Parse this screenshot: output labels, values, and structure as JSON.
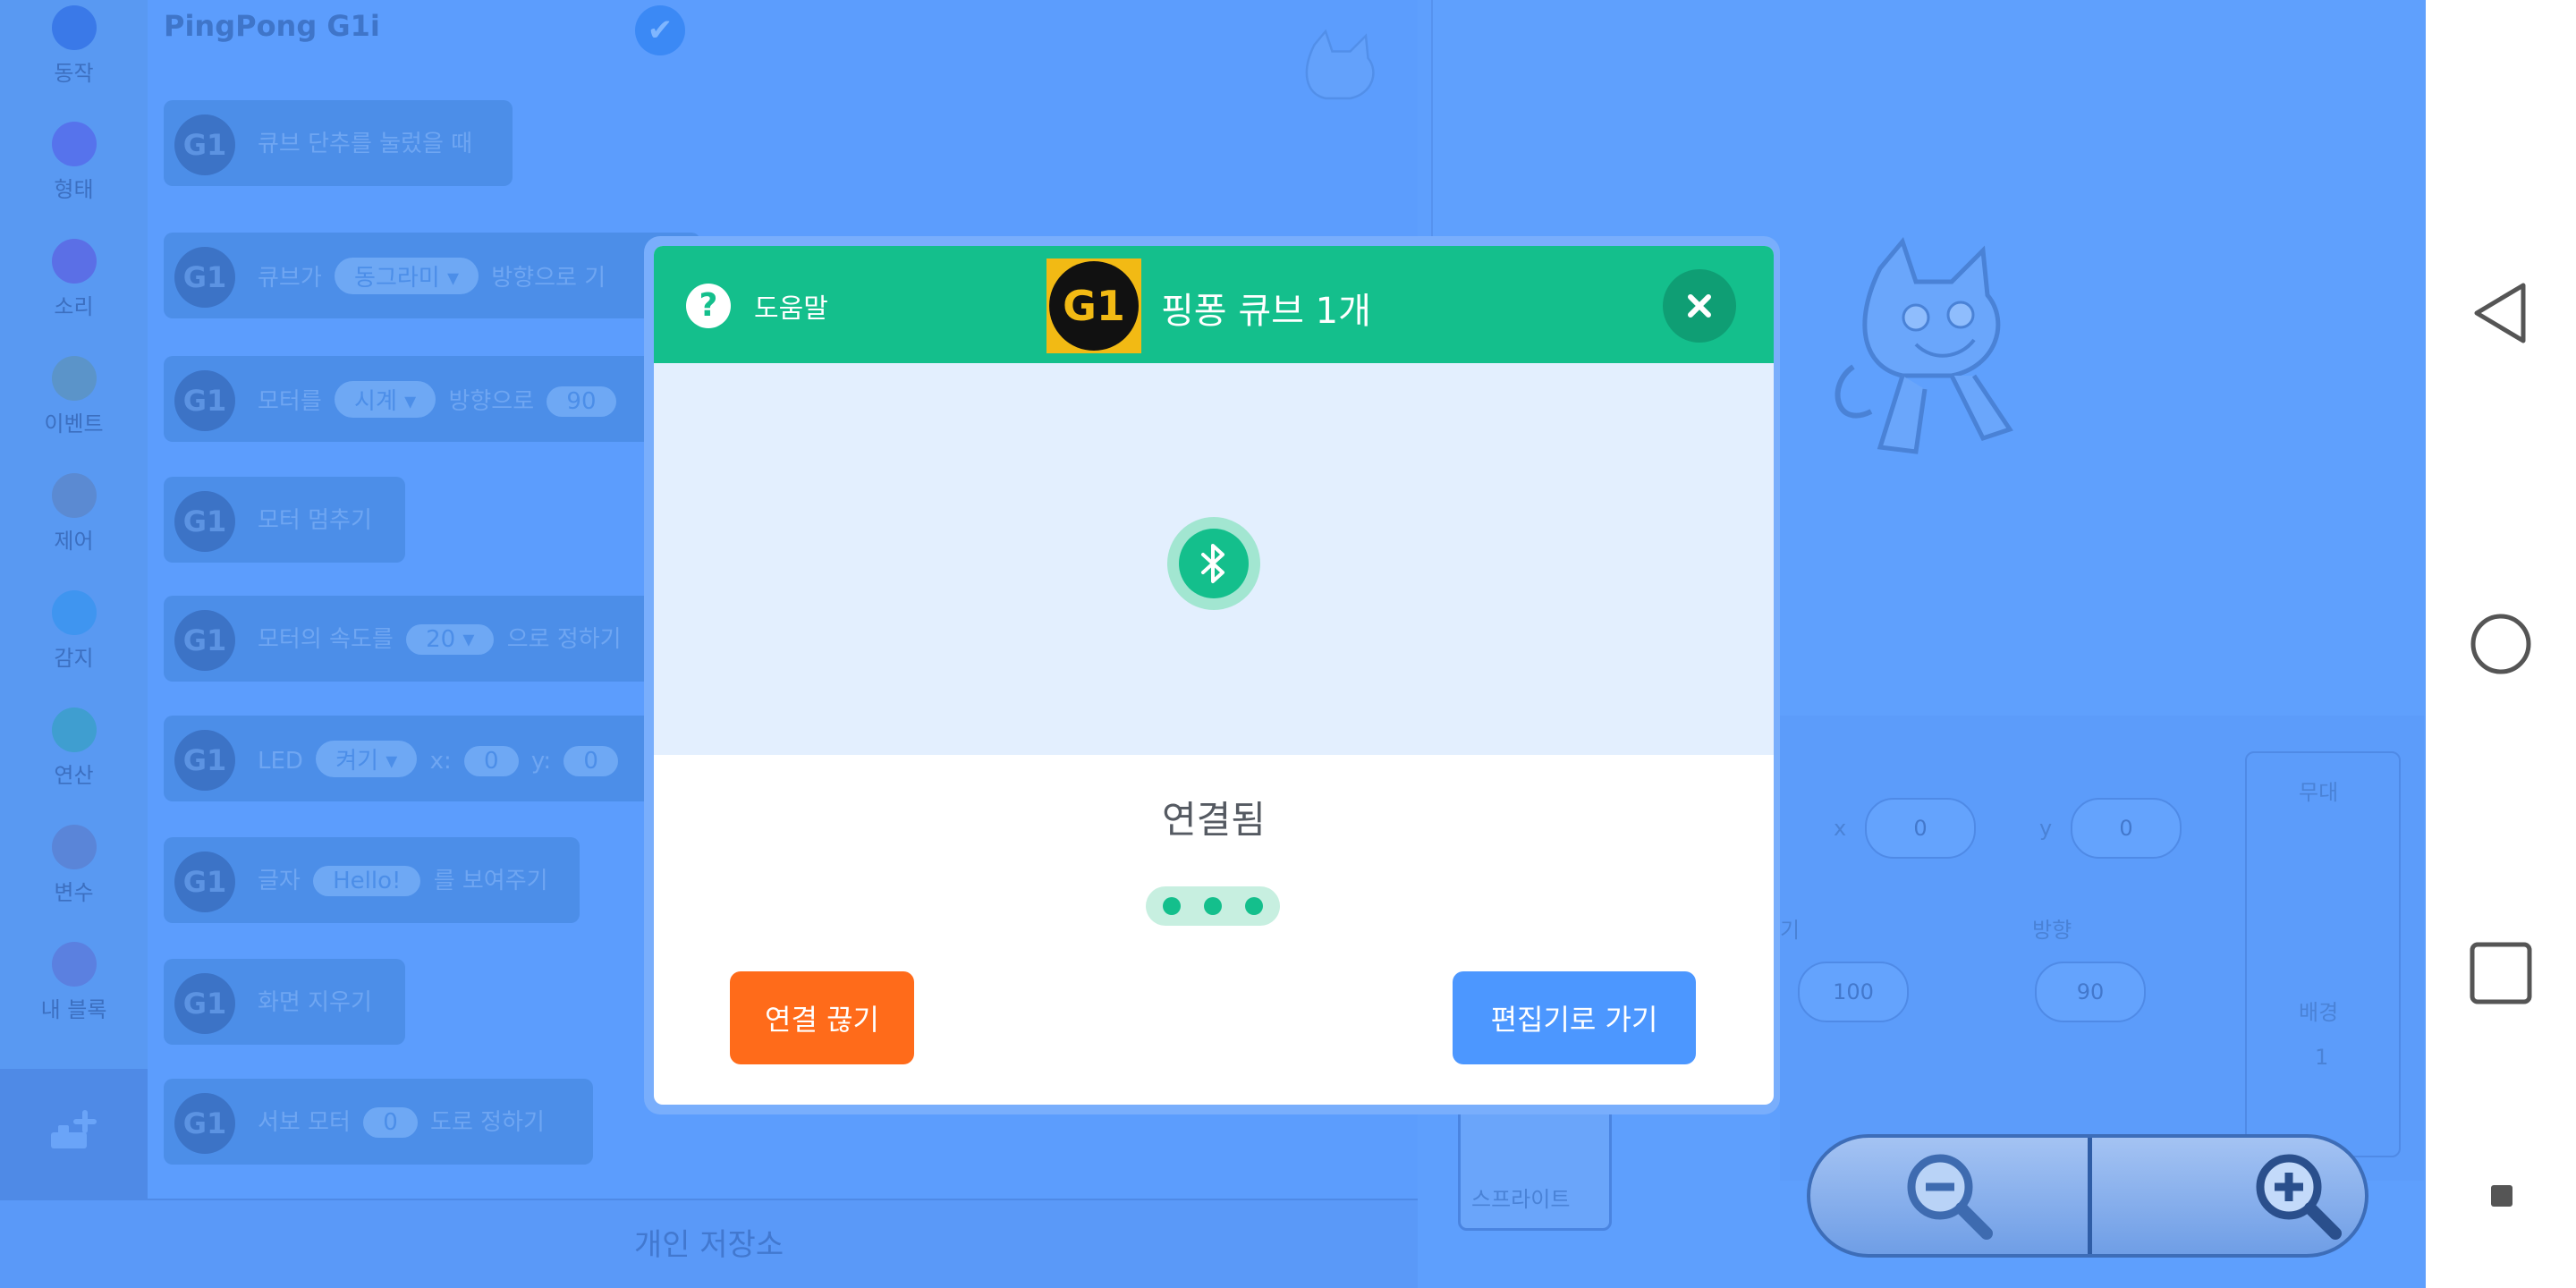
{
  "categories": [
    {
      "label": "동작",
      "color": "#3a79e8"
    },
    {
      "label": "형태",
      "color": "#5673ec"
    },
    {
      "label": "소리",
      "color": "#5b6fe6"
    },
    {
      "label": "이벤트",
      "color": "#5b94c9"
    },
    {
      "label": "제어",
      "color": "#5b8ad2"
    },
    {
      "label": "감지",
      "color": "#3f95f0"
    },
    {
      "label": "연산",
      "color": "#3f9ed0"
    },
    {
      "label": "변수",
      "color": "#5a85d8"
    },
    {
      "label": "내 블록",
      "color": "#5b80e0"
    }
  ],
  "palette": {
    "extension_title": "PingPong G1i",
    "g1_label": "G1",
    "blocks": [
      {
        "parts": [
          "큐브 단추를 눌렀을 때"
        ]
      },
      {
        "parts": [
          "큐브가",
          "동그라미 ▾",
          "방향으로 기"
        ]
      },
      {
        "parts": [
          "모터를",
          "시계 ▾",
          "방향으로",
          "90"
        ]
      },
      {
        "parts": [
          "모터 멈추기"
        ]
      },
      {
        "parts": [
          "모터의 속도를",
          "20 ▾",
          "으로 정하기"
        ]
      },
      {
        "parts": [
          "LED",
          "켜기 ▾",
          "x:",
          "0",
          "y:",
          "0"
        ]
      },
      {
        "parts": [
          "글자",
          "Hello!",
          "를 보여주기"
        ]
      },
      {
        "parts": [
          "화면 지우기"
        ]
      },
      {
        "parts": [
          "서보 모터",
          "0",
          "도로 정하기"
        ]
      }
    ],
    "save_label": "개인 저장소"
  },
  "sprite_panel": {
    "x_label": "x",
    "x_value": "0",
    "y_label": "y",
    "y_value": "0",
    "size_label": "기",
    "size_value": "100",
    "direction_label": "방향",
    "direction_value": "90",
    "stage_label": "무대",
    "backdrop_label": "배경",
    "backdrop_count": "1",
    "sprite_name": "스프라이트"
  },
  "modal": {
    "help_label": "도움말",
    "logo_text": "G1",
    "title": "핑퐁 큐브 1개",
    "status": "연결됨",
    "disconnect_label": "연결 끊기",
    "go_editor_label": "편집기로 가기"
  },
  "colors": {
    "modal_header": "#14bf8c",
    "disconnect_button": "#ff6b1a",
    "go_editor_button": "#4c97ff",
    "overlay": "#5c9dfd"
  },
  "icons": {
    "help": "question-mark",
    "close": "x-mark",
    "bluetooth": "bluetooth",
    "zoom_out": "magnifier-minus",
    "zoom_in": "magnifier-plus",
    "nav_back": "triangle-left",
    "nav_home": "circle",
    "nav_recents": "square"
  }
}
